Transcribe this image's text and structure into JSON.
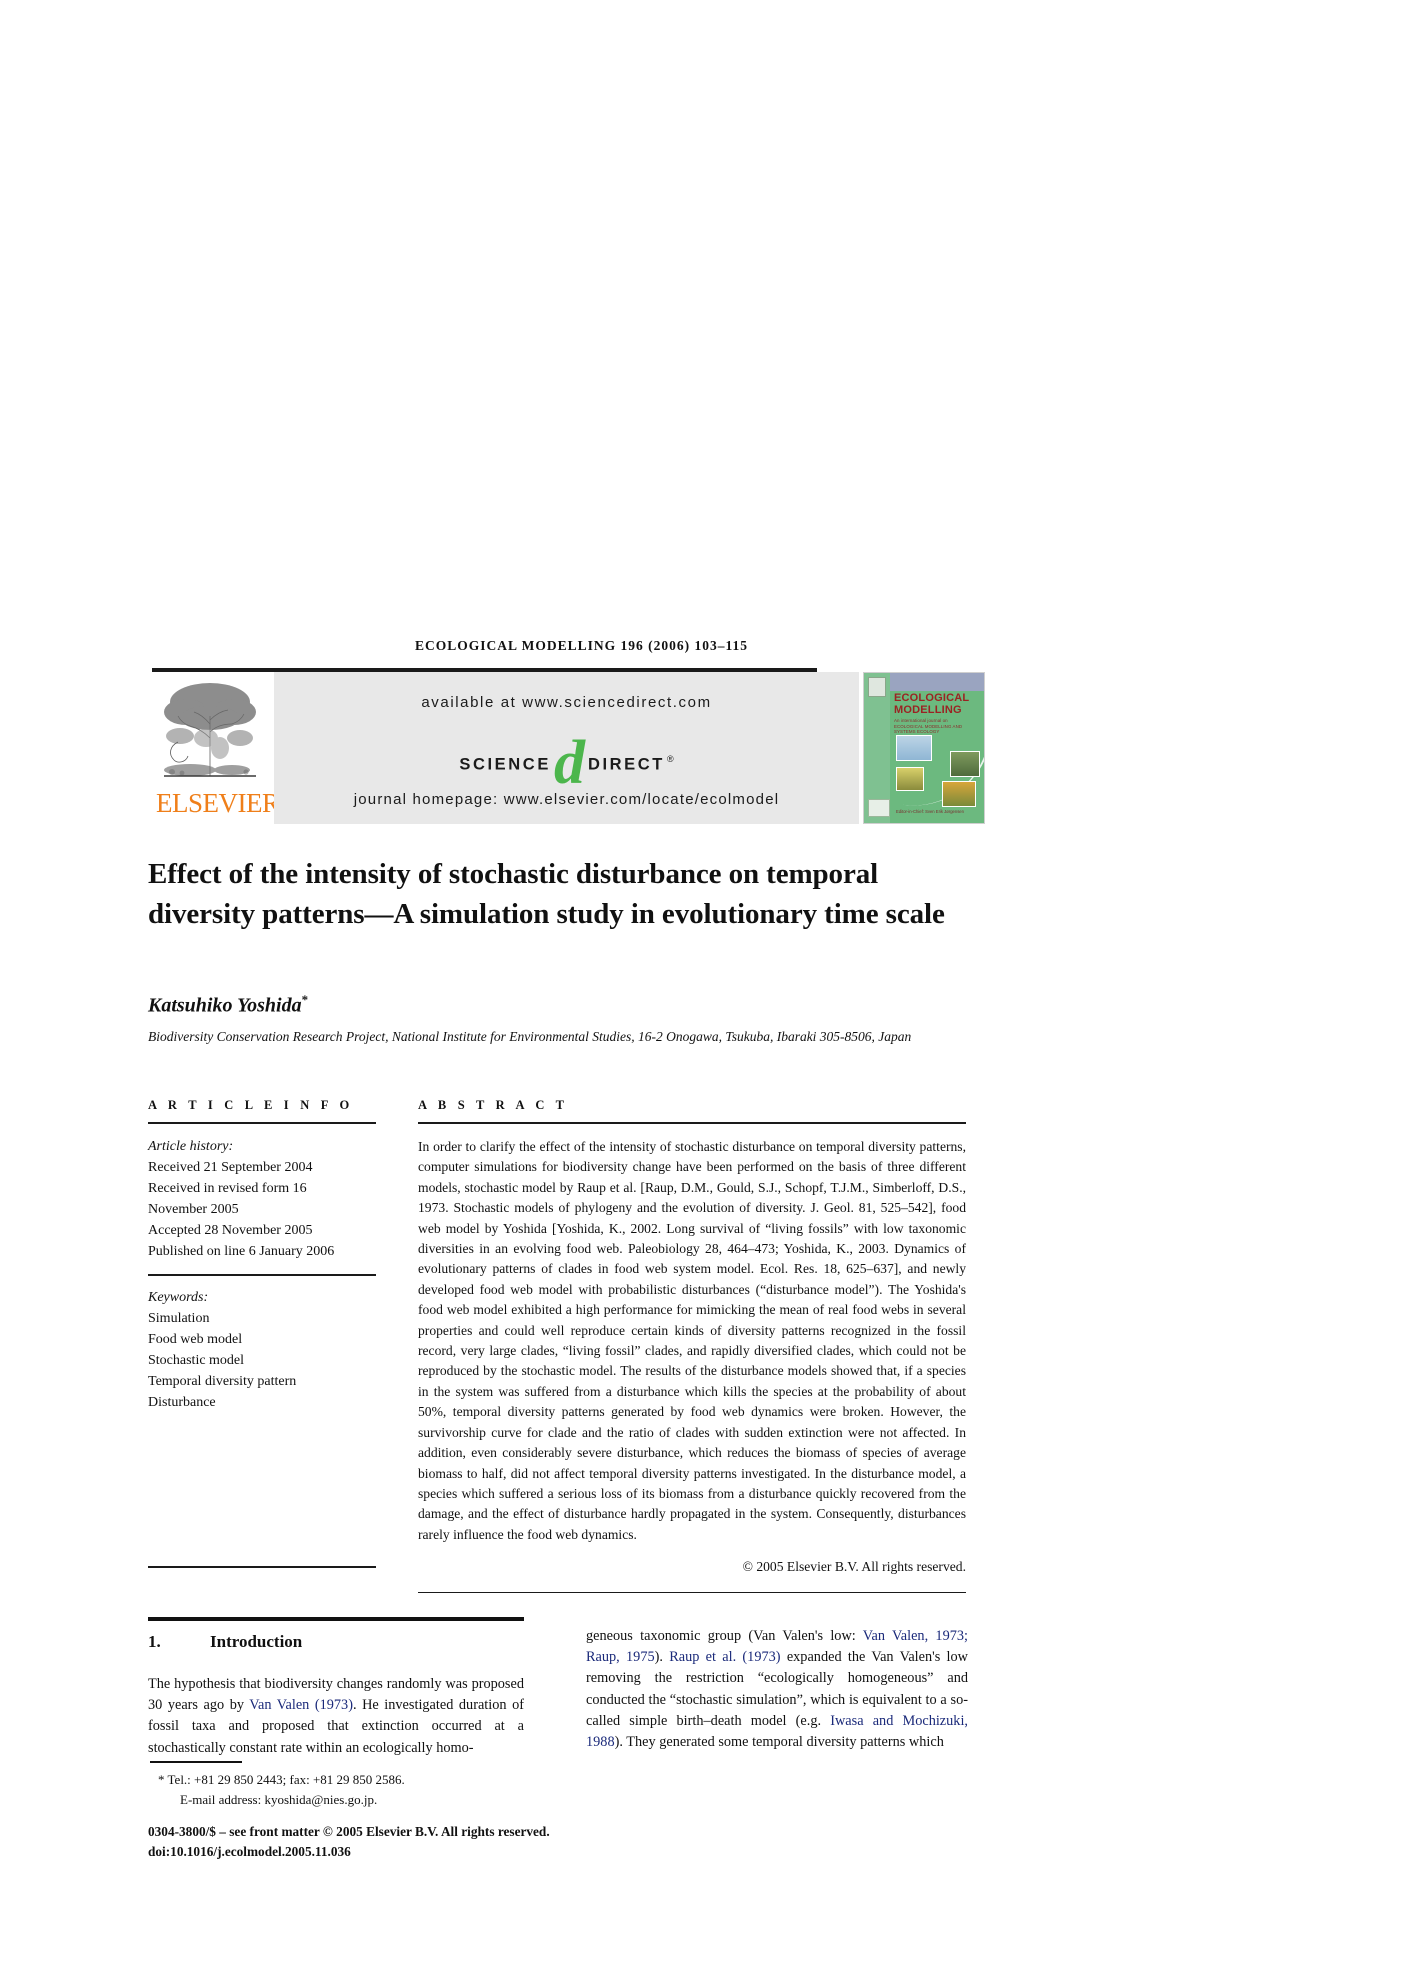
{
  "running_head": "ECOLOGICAL MODELLING 196 (2006) 103–115",
  "masthead": {
    "publisher_name": "ELSEVIER",
    "available_at": "available at www.sciencedirect.com",
    "logo_science": "SCIENCE",
    "logo_d": "d",
    "logo_direct": "DIRECT",
    "logo_reg": "®",
    "homepage": "journal homepage: www.elsevier.com/locate/ecolmodel",
    "cover": {
      "title_line1": "ECOLOGICAL",
      "title_line2": "MODELLING",
      "subtitle": "An international journal on ECOLOGICAL MODELLING AND SYSTEMS ECOLOGY",
      "footer": "Editor-in-Chief: Sven Erik Jørgensen"
    }
  },
  "article": {
    "title": "Effect of the intensity of stochastic disturbance on temporal diversity patterns—A simulation study in evolutionary time scale",
    "author": "Katsuhiko Yoshida",
    "author_marker": "*",
    "affiliation": "Biodiversity Conservation Research Project, National Institute for Environmental Studies, 16-2 Onogawa, Tsukuba, Ibaraki 305-8506, Japan"
  },
  "info": {
    "heading": "A R T I C L E    I N F O",
    "history_label": "Article history:",
    "history": [
      "Received 21 September 2004",
      "Received in revised form 16",
      "November 2005",
      "Accepted 28 November 2005",
      "Published on line 6 January 2006"
    ],
    "keywords_label": "Keywords:",
    "keywords": [
      "Simulation",
      "Food web model",
      "Stochastic model",
      "Temporal diversity pattern",
      "Disturbance"
    ]
  },
  "abstract": {
    "heading": "A B S T R A C T",
    "body": "In order to clarify the effect of the intensity of stochastic disturbance on temporal diversity patterns, computer simulations for biodiversity change have been performed on the basis of three different models, stochastic model by Raup et al. [Raup, D.M., Gould, S.J., Schopf, T.J.M., Simberloff, D.S., 1973. Stochastic models of phylogeny and the evolution of diversity. J. Geol. 81, 525–542], food web model by Yoshida [Yoshida, K., 2002. Long survival of “living fossils” with low taxonomic diversities in an evolving food web. Paleobiology 28, 464–473; Yoshida, K., 2003. Dynamics of evolutionary patterns of clades in food web system model. Ecol. Res. 18, 625–637], and newly developed food web model with probabilistic disturbances (“disturbance model”). The Yoshida's food web model exhibited a high performance for mimicking the mean of real food webs in several properties and could well reproduce certain kinds of diversity patterns recognized in the fossil record, very large clades, “living fossil” clades, and rapidly diversified clades, which could not be reproduced by the stochastic model. The results of the disturbance models showed that, if a species in the system was suffered from a disturbance which kills the species at the probability of about 50%, temporal diversity patterns generated by food web dynamics were broken. However, the survivorship curve for clade and the ratio of clades with sudden extinction were not affected. In addition, even considerably severe disturbance, which reduces the biomass of species of average biomass to half, did not affect temporal diversity patterns investigated. In the disturbance model, a species which suffered a serious loss of its biomass from a disturbance quickly recovered from the damage, and the effect of disturbance hardly propagated in the system. Consequently, disturbances rarely influence the food web dynamics.",
    "copyright": "© 2005 Elsevier B.V. All rights reserved."
  },
  "introduction": {
    "number": "1.",
    "heading": "Introduction",
    "left_p1_a": "The hypothesis that biodiversity changes randomly was proposed 30 years ago by ",
    "left_link1": "Van Valen (1973)",
    "left_p1_b": ". He investigated duration of fossil taxa and proposed that extinction occurred at a stochastically constant rate within an ecologically homo-",
    "right_a": "geneous taxonomic group (Van Valen's low: ",
    "right_link1": "Van Valen, 1973; Raup, 1975",
    "right_b": "). ",
    "right_link2": "Raup et al. (1973)",
    "right_c": " expanded the Van Valen's low removing the restriction “ecologically homogeneous” and conducted the “stochastic simulation”, which is equivalent to a so-called simple birth–death model (e.g. ",
    "right_link3": "Iwasa and Mochizuki, 1988",
    "right_d": "). They generated some temporal diversity patterns which"
  },
  "footnote": {
    "marker": "*",
    "tel": "Tel.: +81 29 850 2443; fax: +81 29 850 2586.",
    "email": "E-mail address: kyoshida@nies.go.jp.",
    "imprint_line1": "0304-3800/$ – see front matter © 2005 Elsevier B.V. All rights reserved.",
    "imprint_line2": "doi:10.1016/j.ecolmodel.2005.11.036"
  },
  "colors": {
    "elsevier_orange": "#ef7f1a",
    "sciencedirect_green": "#4cb64c",
    "banner_gray": "#e8e8e8",
    "link_blue": "#1b2a7a",
    "cover_green": "#6cb97f",
    "cover_title_red": "#9b2323"
  }
}
